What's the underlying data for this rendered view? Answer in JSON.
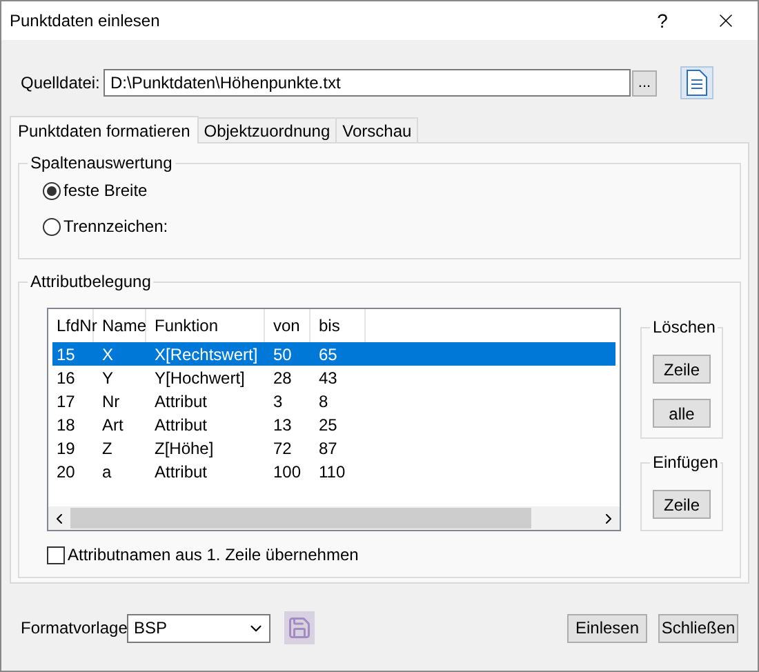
{
  "window": {
    "title": "Punktdaten einlesen",
    "help": "?"
  },
  "source": {
    "label": "Quelldatei:",
    "value": "D:\\Punktdaten\\Höhenpunkte.txt",
    "browse": "..."
  },
  "tabs": [
    {
      "label": "Punktdaten formatieren",
      "selected": true
    },
    {
      "label": "Objektzuordnung",
      "selected": false
    },
    {
      "label": "Vorschau",
      "selected": false
    }
  ],
  "column_evaluation": {
    "title": "Spaltenauswertung",
    "options": [
      {
        "label": "feste Breite",
        "selected": true
      },
      {
        "label": "Trennzeichen:",
        "selected": false
      }
    ]
  },
  "attributes": {
    "title": "Attributbelegung",
    "table": {
      "columns": [
        "LfdNr",
        "Name",
        "Funktion",
        "von",
        "bis"
      ],
      "rows": [
        {
          "cells": [
            "15",
            "X",
            "X[Rechtswert]",
            "50",
            "65"
          ],
          "selected": true
        },
        {
          "cells": [
            "16",
            "Y",
            "Y[Hochwert]",
            "28",
            "43"
          ],
          "selected": false
        },
        {
          "cells": [
            "17",
            "Nr",
            "Attribut",
            "3",
            "8"
          ],
          "selected": false
        },
        {
          "cells": [
            "18",
            "Art",
            "Attribut",
            "13",
            "25"
          ],
          "selected": false
        },
        {
          "cells": [
            "19",
            "Z",
            "Z[Höhe]",
            "72",
            "87"
          ],
          "selected": false
        },
        {
          "cells": [
            "20",
            "a",
            "Attribut",
            "100",
            "110"
          ],
          "selected": false
        }
      ]
    },
    "delete_group": {
      "title": "Löschen",
      "buttons": [
        "Zeile",
        "alle"
      ]
    },
    "insert_group": {
      "title": "Einfügen",
      "buttons": [
        "Zeile"
      ]
    },
    "header_checkbox": {
      "label": "Attributnamen aus 1. Zeile übernehmen",
      "checked": false
    }
  },
  "footer": {
    "template_label": "Formatvorlage",
    "template_value": "BSP",
    "buttons": [
      "Einlesen",
      "Schließen"
    ]
  }
}
